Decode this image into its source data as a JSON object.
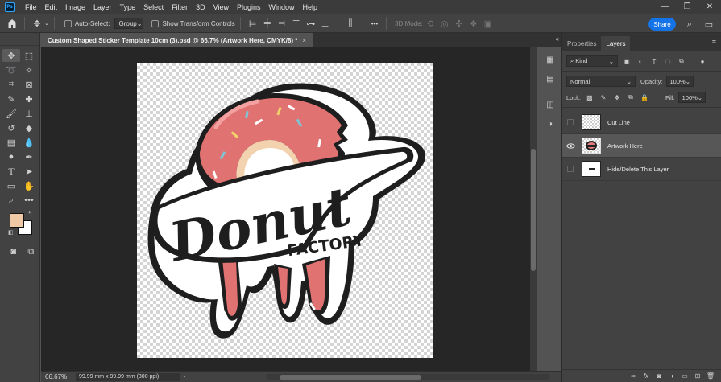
{
  "app": {
    "logo": "Ps",
    "menu": [
      "File",
      "Edit",
      "Image",
      "Layer",
      "Type",
      "Select",
      "Filter",
      "3D",
      "View",
      "Plugins",
      "Window",
      "Help"
    ],
    "window_controls": [
      "—",
      "❐",
      "✕"
    ]
  },
  "options_bar": {
    "auto_select_label": "Auto-Select:",
    "auto_select_value": "Group",
    "show_transform_label": "Show Transform Controls",
    "more": "•••",
    "mode_3d": "3D Mode:",
    "share_label": "Share"
  },
  "document": {
    "tab_title": "Custom Shaped Sticker Template 10cm (3).psd @ 66.7% (Artwork Here, CMYK/8) *",
    "close": "×",
    "zoom": "66.67%",
    "info": "99.99 mm x 99.99 mm (300 ppi)"
  },
  "artwork": {
    "title_word": "Donut",
    "subtitle_word": "FACTORY",
    "colors": {
      "pink": "#e07272",
      "pink_highlight": "#f2a0a0",
      "dough": "#f3d2b0",
      "outline": "#1e1e1e",
      "sprinkle_yellow": "#f3d26b",
      "sprinkle_blue": "#7cc6d6",
      "sprinkle_white": "#ffffff"
    }
  },
  "panels": {
    "tabs": [
      "Properties",
      "Layers"
    ],
    "active_tab": "Layers",
    "filter_kind": "Kind",
    "blend_mode": "Normal",
    "opacity_label": "Opacity:",
    "opacity_value": "100%",
    "lock_label": "Lock:",
    "fill_label": "Fill:",
    "fill_value": "100%",
    "layers": [
      {
        "name": "Cut Line",
        "visible": false,
        "selected": false
      },
      {
        "name": "Artwork Here",
        "visible": true,
        "selected": true
      },
      {
        "name": "Hide/Delete This Layer",
        "visible": false,
        "selected": false
      }
    ],
    "footer_icons": [
      "link-icon",
      "fx-icon",
      "mask-icon",
      "adjustment-icon",
      "group-icon",
      "new-layer-icon",
      "trash-icon"
    ]
  },
  "tools": [
    "move",
    "marquee",
    "lasso",
    "magic-wand",
    "crop",
    "frame",
    "eyedropper",
    "healing",
    "brush",
    "stamp",
    "history-brush",
    "eraser",
    "gradient",
    "blur",
    "dodge",
    "pen",
    "type",
    "path-select",
    "rectangle",
    "hand",
    "zoom",
    "more"
  ],
  "swatch_colors": {
    "foreground": "#efc9a5",
    "background": "#ffffff"
  }
}
